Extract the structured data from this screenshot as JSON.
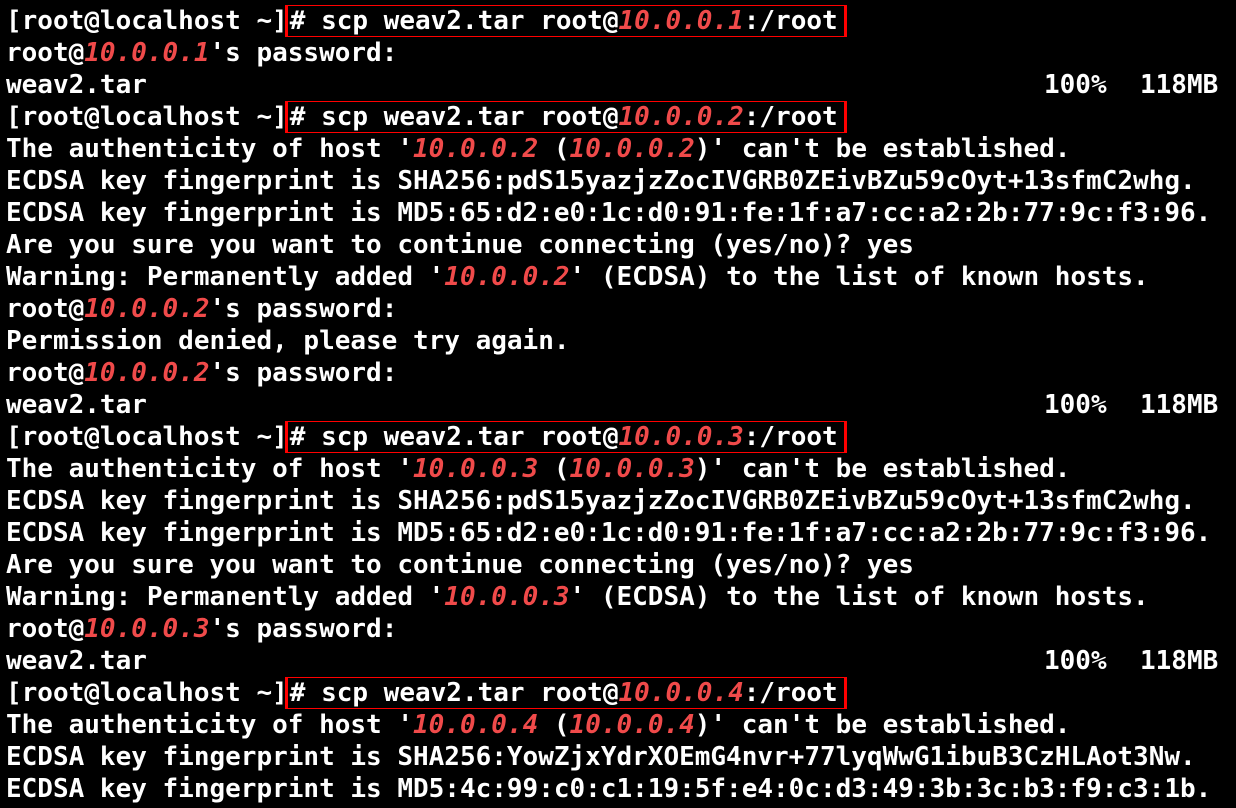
{
  "terminal": {
    "lines": [
      {
        "type": "cmd",
        "prompt": "[root@localhost ~]",
        "cmd_prefix": "# scp weav2.tar root@",
        "ip": "10.0.0.1",
        "cmd_suffix": ":/root"
      },
      {
        "type": "pw",
        "before": "root@",
        "ip": "10.0.0.1",
        "after": "'s password:"
      },
      {
        "type": "transfer",
        "file": "weav2.tar",
        "percent": "100%",
        "size": "118MB"
      },
      {
        "type": "cmd",
        "prompt": "[root@localhost ~]",
        "cmd_prefix": "# scp weav2.tar root@",
        "ip": "10.0.0.2",
        "cmd_suffix": ":/root"
      },
      {
        "type": "auth",
        "before": "The authenticity of host '",
        "ip": "10.0.0.2",
        "mid": " (",
        "ip2": "10.0.0.2",
        "after": ")' can't be established."
      },
      {
        "type": "text",
        "text": "ECDSA key fingerprint is SHA256:pdS15yazjzZocIVGRB0ZEivBZu59cOyt+13sfmC2whg."
      },
      {
        "type": "text",
        "text": "ECDSA key fingerprint is MD5:65:d2:e0:1c:d0:91:fe:1f:a7:cc:a2:2b:77:9c:f3:96."
      },
      {
        "type": "text",
        "text": "Are you sure you want to continue connecting (yes/no)? yes"
      },
      {
        "type": "warn",
        "before": "Warning: Permanently added '",
        "ip": "10.0.0.2",
        "after": "' (ECDSA) to the list of known hosts."
      },
      {
        "type": "pw",
        "before": "root@",
        "ip": "10.0.0.2",
        "after": "'s password:"
      },
      {
        "type": "text",
        "text": "Permission denied, please try again."
      },
      {
        "type": "pw",
        "before": "root@",
        "ip": "10.0.0.2",
        "after": "'s password:"
      },
      {
        "type": "transfer",
        "file": "weav2.tar",
        "percent": "100%",
        "size": "118MB"
      },
      {
        "type": "cmd",
        "prompt": "[root@localhost ~]",
        "cmd_prefix": "# scp weav2.tar root@",
        "ip": "10.0.0.3",
        "cmd_suffix": ":/root"
      },
      {
        "type": "auth",
        "before": "The authenticity of host '",
        "ip": "10.0.0.3",
        "mid": " (",
        "ip2": "10.0.0.3",
        "after": ")' can't be established."
      },
      {
        "type": "text",
        "text": "ECDSA key fingerprint is SHA256:pdS15yazjzZocIVGRB0ZEivBZu59cOyt+13sfmC2whg."
      },
      {
        "type": "text",
        "text": "ECDSA key fingerprint is MD5:65:d2:e0:1c:d0:91:fe:1f:a7:cc:a2:2b:77:9c:f3:96."
      },
      {
        "type": "text",
        "text": "Are you sure you want to continue connecting (yes/no)? yes"
      },
      {
        "type": "warn",
        "before": "Warning: Permanently added '",
        "ip": "10.0.0.3",
        "after": "' (ECDSA) to the list of known hosts."
      },
      {
        "type": "pw",
        "before": "root@",
        "ip": "10.0.0.3",
        "after": "'s password:"
      },
      {
        "type": "transfer",
        "file": "weav2.tar",
        "percent": "100%",
        "size": "118MB"
      },
      {
        "type": "cmd",
        "prompt": "[root@localhost ~]",
        "cmd_prefix": "# scp weav2.tar root@",
        "ip": "10.0.0.4",
        "cmd_suffix": ":/root"
      },
      {
        "type": "auth",
        "before": "The authenticity of host '",
        "ip": "10.0.0.4",
        "mid": " (",
        "ip2": "10.0.0.4",
        "after": ")' can't be established."
      },
      {
        "type": "text",
        "text": "ECDSA key fingerprint is SHA256:YowZjxYdrXOEmG4nvr+77lyqWwG1ibuB3CzHLAot3Nw."
      },
      {
        "type": "text",
        "text": "ECDSA key fingerprint is MD5:4c:99:c0:c1:19:5f:e4:0c:d3:49:3b:3c:b3:f9:c3:1b."
      }
    ]
  },
  "colors": {
    "background": "#000000",
    "text": "#ffffff",
    "ip_highlight": "#f04a4a",
    "annotation_box": "#ff0000"
  }
}
